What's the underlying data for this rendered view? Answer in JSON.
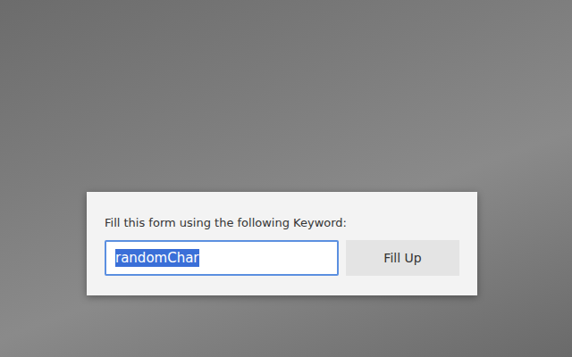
{
  "dialog": {
    "prompt": "Fill this form using the following Keyword:",
    "keyword": {
      "value": "randomChar",
      "selected": true
    },
    "button": "Fill Up"
  }
}
